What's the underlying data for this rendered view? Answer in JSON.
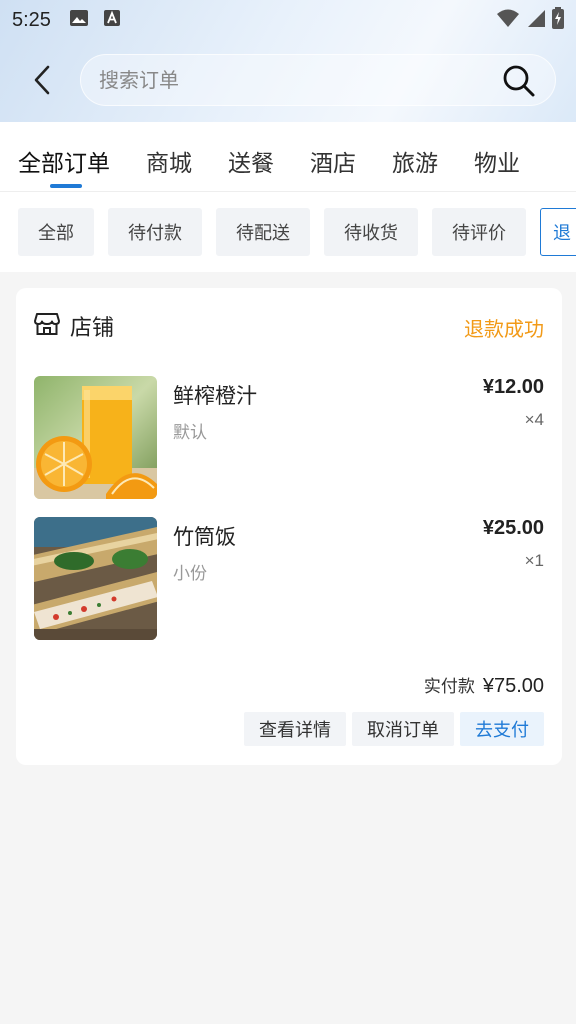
{
  "status_bar": {
    "time": "5:25"
  },
  "search": {
    "placeholder": "搜索订单"
  },
  "tabs": [
    {
      "label": "全部订单",
      "active": true
    },
    {
      "label": "商城"
    },
    {
      "label": "送餐"
    },
    {
      "label": "酒店"
    },
    {
      "label": "旅游"
    },
    {
      "label": "物业"
    }
  ],
  "filters": [
    {
      "label": "全部"
    },
    {
      "label": "待付款"
    },
    {
      "label": "待配送"
    },
    {
      "label": "待收货"
    },
    {
      "label": "待评价"
    },
    {
      "label": "退"
    }
  ],
  "order": {
    "shop_label": "店铺",
    "status": "退款成功",
    "items": [
      {
        "name": "鲜榨橙汁",
        "spec": "默认",
        "price": "¥12.00",
        "qty": "×4",
        "image_icon": "orange-juice-photo"
      },
      {
        "name": "竹筒饭",
        "spec": "小份",
        "price": "¥25.00",
        "qty": "×1",
        "image_icon": "bamboo-rice-photo"
      }
    ],
    "total_label": "实付款",
    "total_value": "¥75.00",
    "actions": {
      "detail": "查看详情",
      "cancel": "取消订单",
      "pay": "去支付"
    }
  },
  "colors": {
    "accent": "#1f7ad6",
    "status_orange": "#f29a17"
  }
}
